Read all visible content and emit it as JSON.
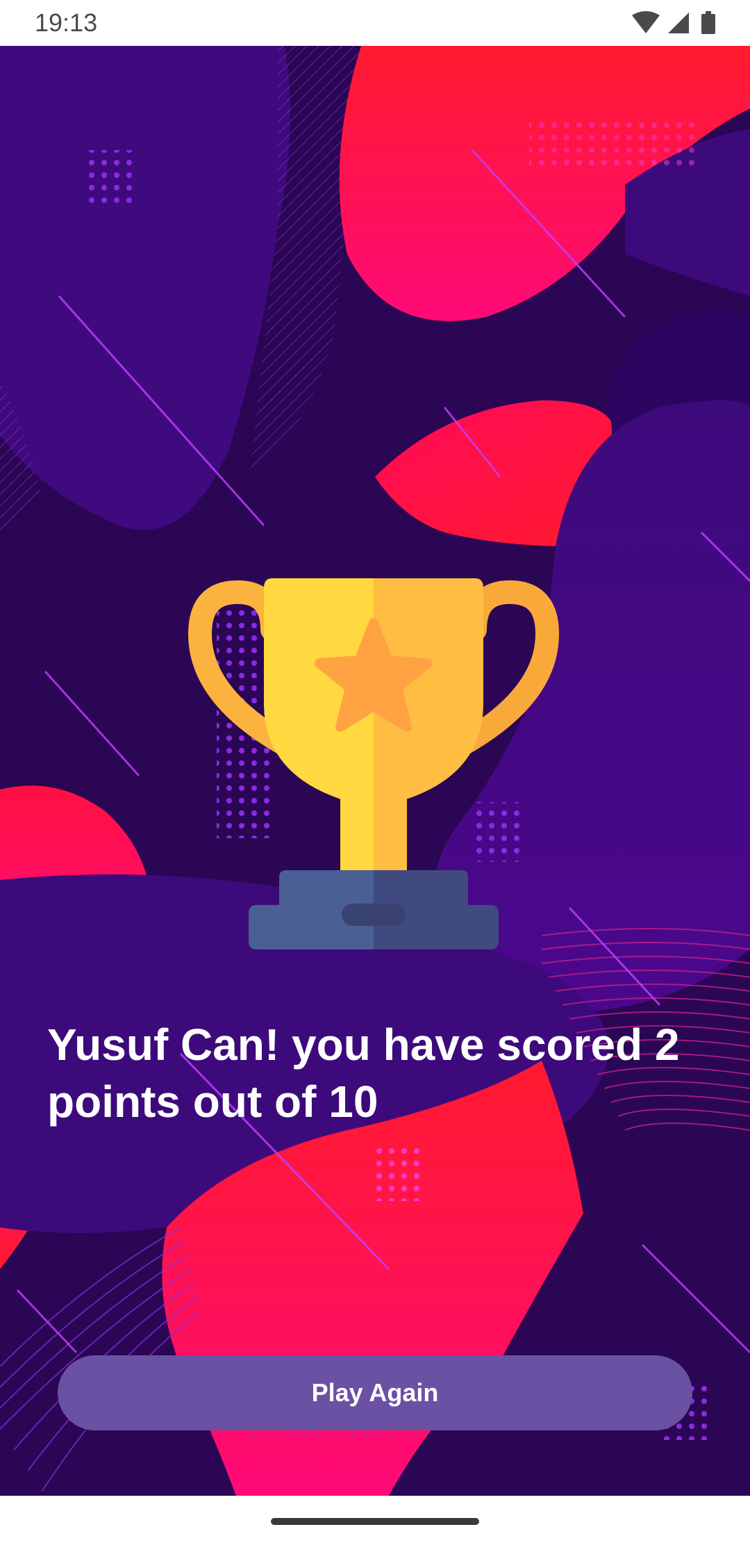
{
  "status_bar": {
    "time": "19:13",
    "icons": [
      "wifi-icon",
      "cell-signal-icon",
      "battery-icon"
    ]
  },
  "result": {
    "message": "Yusuf Can! you have scored 2 points out of 10"
  },
  "actions": {
    "play_again_label": "Play Again"
  },
  "colors": {
    "background": "#2a0654",
    "button": "#6a51a3",
    "accent_red": "#ff1e3c",
    "trophy_gold": "#ffc43d",
    "trophy_base": "#4a5f94"
  }
}
